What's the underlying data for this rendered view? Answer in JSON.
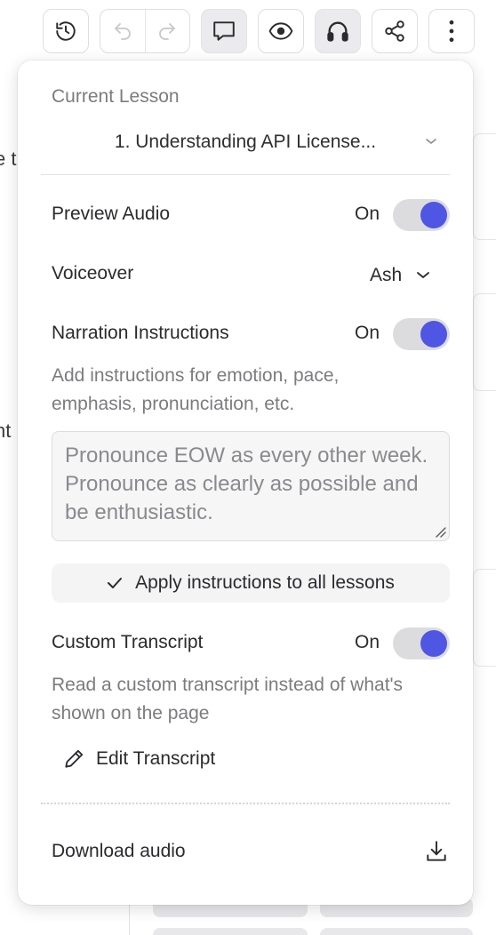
{
  "background": {
    "fragment_1": "e t",
    "fragment_2": "nt"
  },
  "toolbar": {
    "history_icon": "history-icon",
    "undo_icon": "undo-icon",
    "redo_icon": "redo-icon",
    "comment_icon": "comment-icon",
    "preview_icon": "eye-icon",
    "audio_icon": "headphones-icon",
    "share_icon": "share-icon",
    "more_icon": "more-vertical-icon"
  },
  "popover": {
    "current_lesson_label": "Current Lesson",
    "current_lesson_value": "1. Understanding API License...",
    "preview_audio": {
      "label": "Preview Audio",
      "state": "On"
    },
    "voiceover": {
      "label": "Voiceover",
      "value": "Ash"
    },
    "narration": {
      "label": "Narration Instructions",
      "state": "On",
      "helper": "Add instructions for emotion, pace, emphasis, pronunciation, etc.",
      "placeholder": "Pronounce EOW as every other week. Pronounce as clearly as possible and be enthusiastic.",
      "apply_label": "Apply instructions to all lessons"
    },
    "custom_transcript": {
      "label": "Custom Transcript",
      "state": "On",
      "helper": "Read a custom transcript instead of what's shown on the page",
      "edit_label": "Edit Transcript"
    },
    "download_label": "Download audio"
  },
  "colors": {
    "accent": "#4f56e3",
    "toggle_track": "#dcdcdf",
    "muted_text": "#7c7c80"
  }
}
